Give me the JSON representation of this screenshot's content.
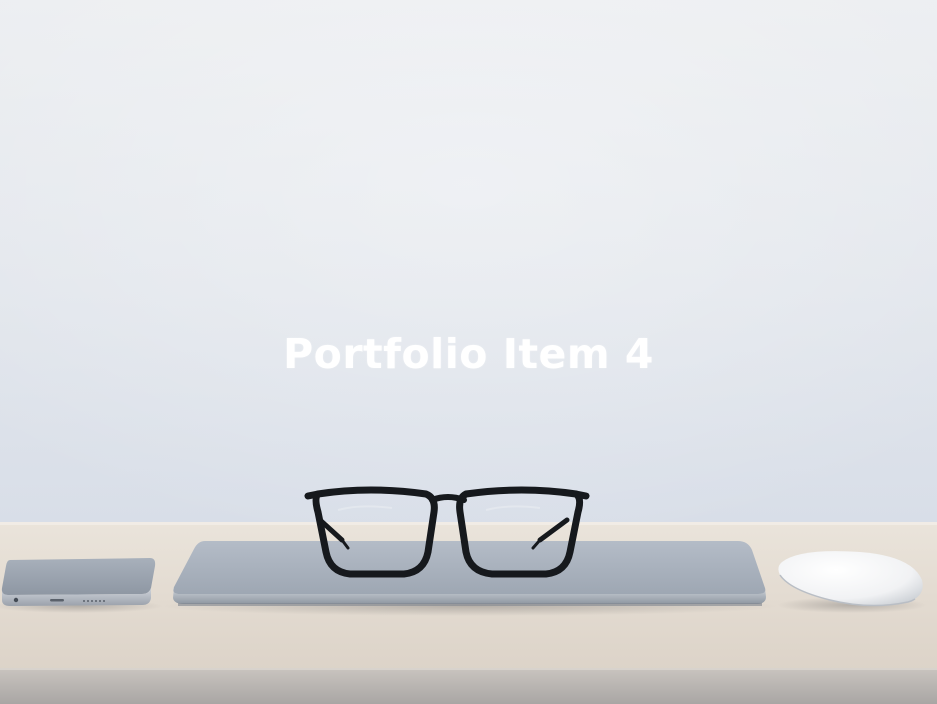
{
  "portfolio_item": {
    "title": "Portfolio Item 4",
    "image_subject": "glasses-on-laptop-desk"
  },
  "colors": {
    "wall_top": "#e9ecef",
    "wall_bottom": "#d9e0ea",
    "desk": "#e4dcd2",
    "desk_front": "#bdb8b3",
    "laptop": "#a9b2be",
    "title_text": "#ffffff"
  }
}
